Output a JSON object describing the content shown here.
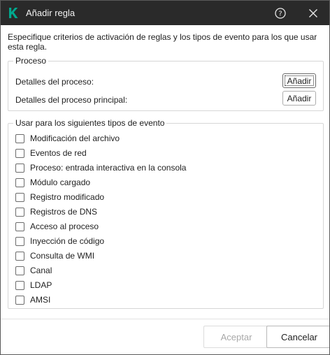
{
  "window": {
    "title": "Añadir regla",
    "accent_color": "#00a88e",
    "titlebar_color": "#2a2a2a",
    "icons": [
      "kaspersky-logo",
      "help-icon",
      "close-icon"
    ]
  },
  "description": "Especifique criterios de activación de reglas y los tipos de evento para los que usar esta regla.",
  "process_group": {
    "legend": "Proceso",
    "rows": [
      {
        "label": "Detalles del proceso:",
        "button": "Añadir"
      },
      {
        "label": "Detalles del proceso principal:",
        "button": "Añadir"
      }
    ]
  },
  "events_group": {
    "legend": "Usar para los siguientes tipos de evento",
    "items": [
      {
        "label": "Modificación del archivo",
        "checked": false
      },
      {
        "label": "Eventos de red",
        "checked": false
      },
      {
        "label": "Proceso: entrada interactiva en la consola",
        "checked": false
      },
      {
        "label": "Módulo cargado",
        "checked": false
      },
      {
        "label": "Registro modificado",
        "checked": false
      },
      {
        "label": "Registros de DNS",
        "checked": false
      },
      {
        "label": "Acceso al proceso",
        "checked": false
      },
      {
        "label": "Inyección de código",
        "checked": false
      },
      {
        "label": "Consulta de WMI",
        "checked": false
      },
      {
        "label": "Canal",
        "checked": false
      },
      {
        "label": "LDAP",
        "checked": false
      },
      {
        "label": "AMSI",
        "checked": false
      }
    ]
  },
  "footer": {
    "accept_label": "Aceptar",
    "accept_enabled": false,
    "cancel_label": "Cancelar"
  }
}
